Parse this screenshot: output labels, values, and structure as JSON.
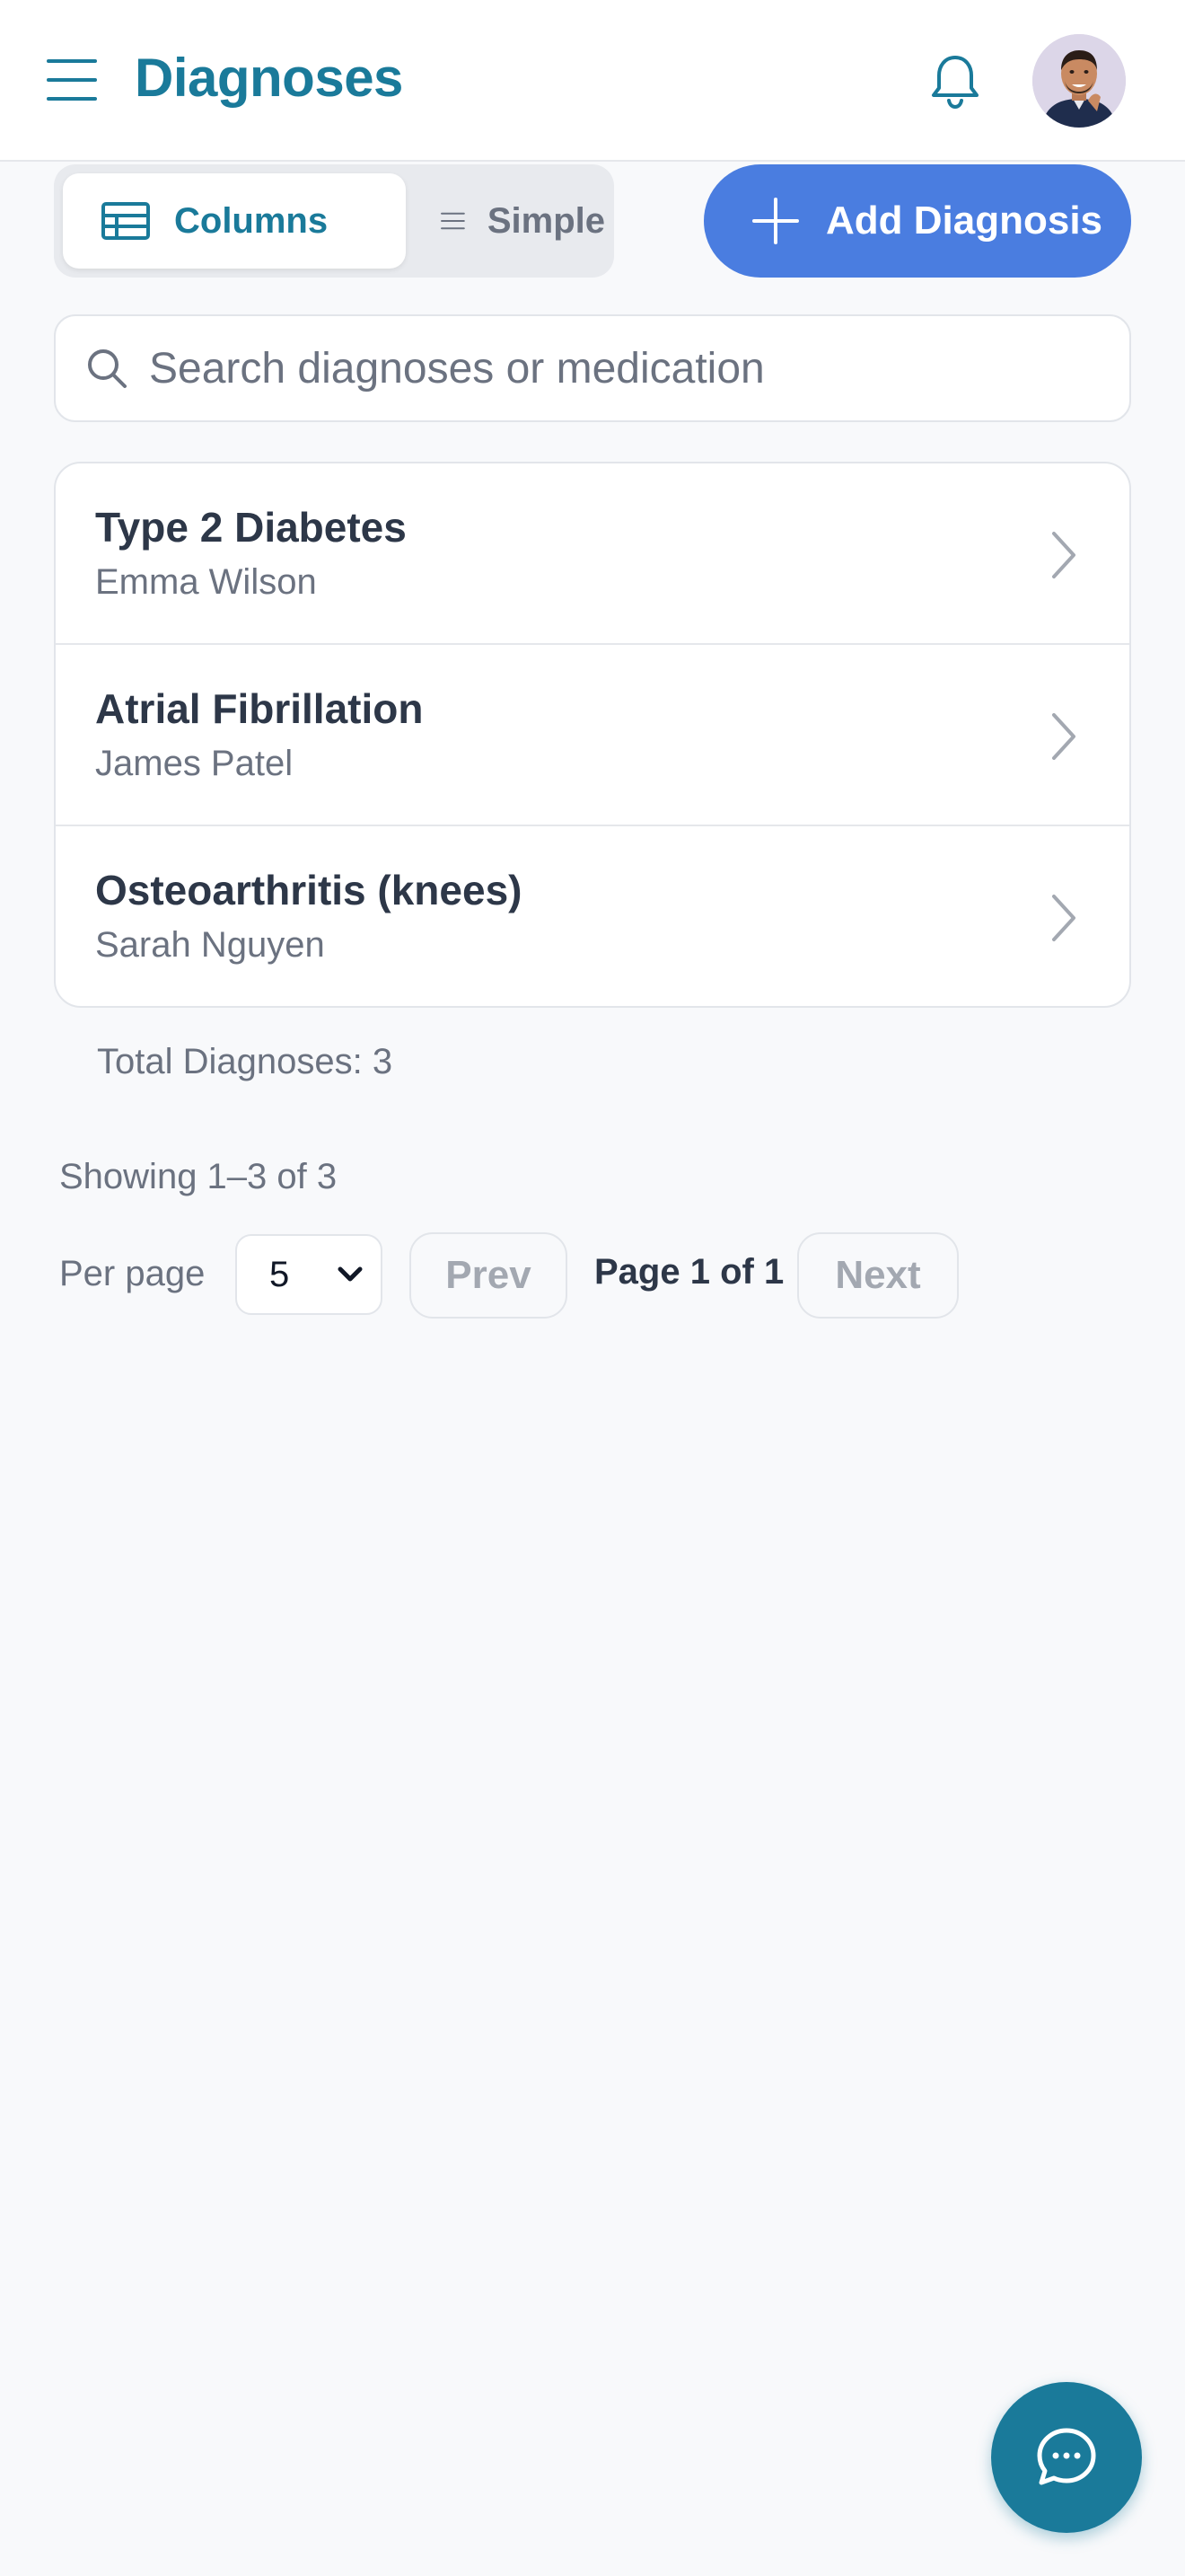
{
  "header": {
    "title": "Diagnoses",
    "menu_icon": "hamburger-menu-icon",
    "bell_icon": "bell-icon",
    "avatar": "user-avatar"
  },
  "toolbar": {
    "view_columns_label": "Columns",
    "view_simple_label": "Simple",
    "active_view": "Columns",
    "add_label": "Add Diagnosis"
  },
  "search": {
    "placeholder": "Search diagnoses or medication",
    "value": ""
  },
  "diagnoses": [
    {
      "diagnosis": "Type 2 Diabetes",
      "patient": "Emma Wilson"
    },
    {
      "diagnosis": "Atrial Fibrillation",
      "patient": "James Patel"
    },
    {
      "diagnosis": "Osteoarthritis (knees)",
      "patient": "Sarah Nguyen"
    }
  ],
  "summary": {
    "total": "Total Diagnoses: 3",
    "showing": "Showing 1–3 of 3"
  },
  "pagination": {
    "per_page_label": "Per page",
    "per_page_value": "5",
    "prev_label": "Prev",
    "page_info": "Page 1 of 1",
    "next_label": "Next"
  },
  "colors": {
    "brand": "#1a7a9a",
    "primary_button": "#4a7de0",
    "background": "#f8f9fb"
  }
}
